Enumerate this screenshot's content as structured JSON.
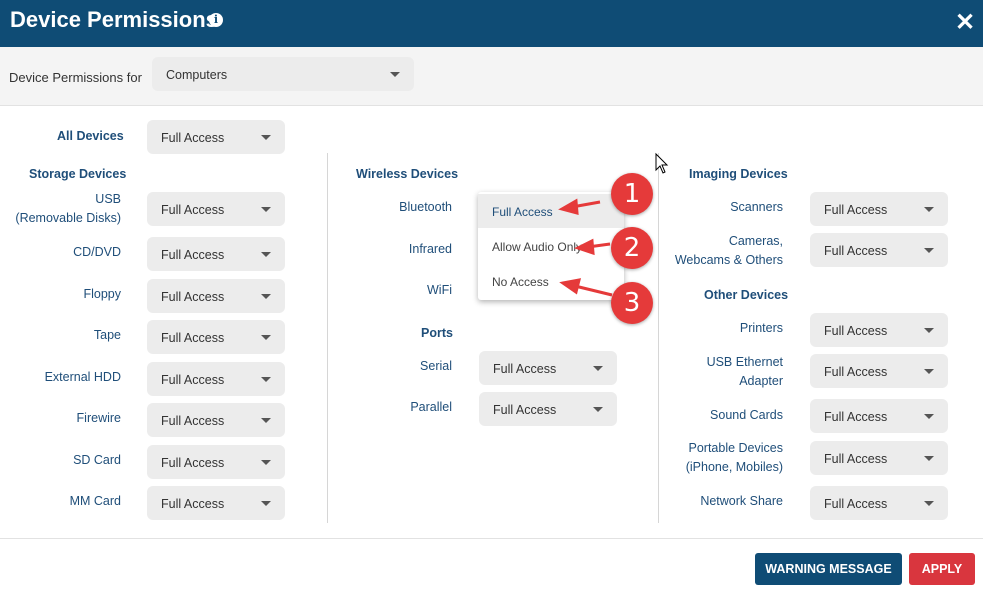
{
  "header": {
    "title": "Device Permissions",
    "info_icon": "i",
    "close_icon": "✕"
  },
  "permissions_for": {
    "label": "Device Permissions for",
    "value": "Computers"
  },
  "all_devices": {
    "label": "All Devices",
    "value": "Full Access"
  },
  "storage": {
    "heading": "Storage Devices",
    "items": [
      {
        "label": "USB\n(Removable Disks)",
        "value": "Full Access"
      },
      {
        "label": "CD/DVD",
        "value": "Full Access"
      },
      {
        "label": "Floppy",
        "value": "Full Access"
      },
      {
        "label": "Tape",
        "value": "Full Access"
      },
      {
        "label": "External HDD",
        "value": "Full Access"
      },
      {
        "label": "Firewire",
        "value": "Full Access"
      },
      {
        "label": "SD Card",
        "value": "Full Access"
      },
      {
        "label": "MM Card",
        "value": "Full Access"
      }
    ]
  },
  "wireless": {
    "heading": "Wireless Devices",
    "items": [
      {
        "label": "Bluetooth"
      },
      {
        "label": "Infrared"
      },
      {
        "label": "WiFi"
      }
    ],
    "dropdown_options": [
      "Full Access",
      "Allow Audio Only",
      "No Access"
    ]
  },
  "ports": {
    "heading": "Ports",
    "items": [
      {
        "label": "Serial",
        "value": "Full Access"
      },
      {
        "label": "Parallel",
        "value": "Full Access"
      }
    ]
  },
  "imaging": {
    "heading": "Imaging Devices",
    "items": [
      {
        "label": "Scanners",
        "value": "Full Access"
      },
      {
        "label": "Cameras,\nWebcams & Others",
        "value": "Full Access"
      }
    ]
  },
  "other": {
    "heading": "Other Devices",
    "items": [
      {
        "label": "Printers",
        "value": "Full Access"
      },
      {
        "label": "USB Ethernet\nAdapter",
        "value": "Full Access"
      },
      {
        "label": "Sound Cards",
        "value": "Full Access"
      },
      {
        "label": "Portable Devices\n(iPhone, Mobiles)",
        "value": "Full Access"
      },
      {
        "label": "Network Share",
        "value": "Full Access"
      }
    ]
  },
  "annotations": [
    "1",
    "2",
    "3"
  ],
  "footer": {
    "warning_label": "WARNING MESSAGE",
    "apply_label": "APPLY"
  },
  "colors": {
    "header_bg": "#0f4c75",
    "label_blue": "#1f4e79",
    "warning_btn": "#0f4c75",
    "apply_btn": "#d9363e",
    "annotation_red": "#e53a3a"
  }
}
